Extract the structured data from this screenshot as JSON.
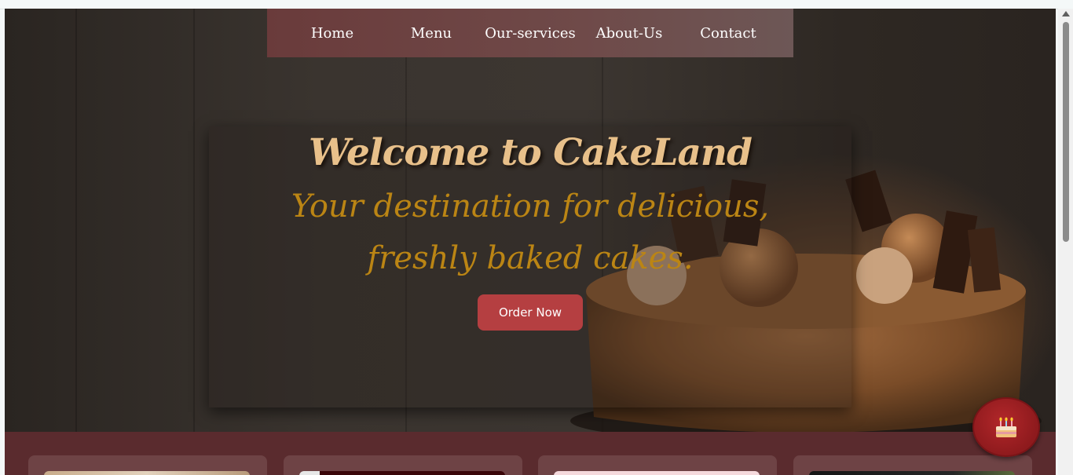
{
  "nav": {
    "items": [
      {
        "label": "Home"
      },
      {
        "label": "Menu"
      },
      {
        "label": "Our-services"
      },
      {
        "label": "About-Us"
      },
      {
        "label": "Contact"
      }
    ]
  },
  "hero": {
    "title": "Welcome to CakeLand",
    "subtitle": "Your destination for delicious, freshly baked cakes.",
    "order_button": "Order Now"
  },
  "floating_button": {
    "icon": "birthday-cake-icon"
  },
  "colors": {
    "nav_background": "#6a3b3b",
    "title": "#e8c08a",
    "subtitle": "#bb8514",
    "order_button": "#b53f41",
    "menu_strip": "#5a2b2e",
    "floating_button": "#a32225"
  }
}
